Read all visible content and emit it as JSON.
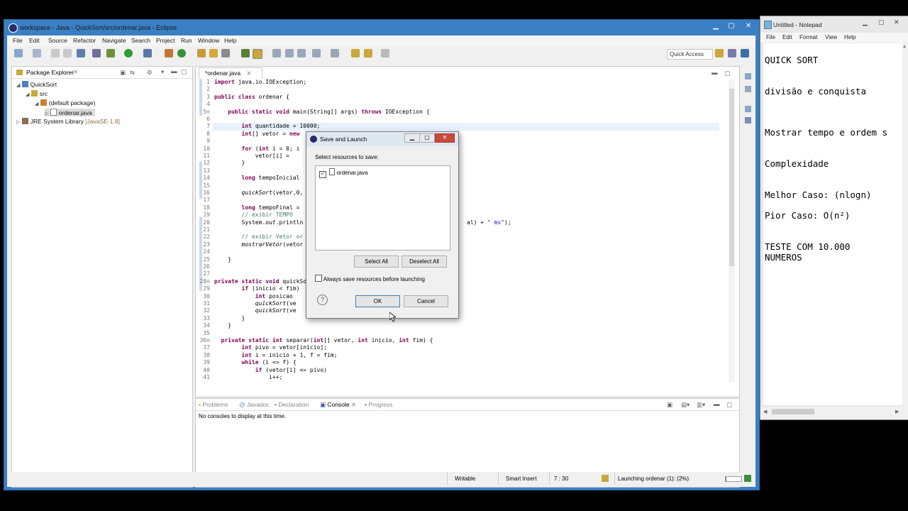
{
  "eclipse": {
    "title": "workspace - Java - QuickSort/src/ordenar.java - Eclipse",
    "menus": [
      "File",
      "Edit",
      "Source",
      "Refactor",
      "Navigate",
      "Search",
      "Project",
      "Run",
      "Window",
      "Help"
    ],
    "quick_access": "Quick Access"
  },
  "package_explorer": {
    "tab_label": "Package Explorer",
    "tree": [
      {
        "label": "QuickSort",
        "level": 0
      },
      {
        "label": "src",
        "level": 1
      },
      {
        "label": "(default package)",
        "level": 2
      },
      {
        "label": "ordenar.java",
        "level": 3
      },
      {
        "label": "JRE System Library",
        "suffix": "[JavaSE-1.8]",
        "level": 0
      }
    ]
  },
  "editor": {
    "tab_label": "*ordenar.java",
    "lines": [
      {
        "n": "1",
        "t": "import java.io.IOException;"
      },
      {
        "n": "2",
        "t": ""
      },
      {
        "n": "3",
        "t": "public class ordenar {"
      },
      {
        "n": "4",
        "t": ""
      },
      {
        "n": "5⊖",
        "t": "    public static void main(String[] args) throws IOException {"
      },
      {
        "n": "6",
        "t": ""
      },
      {
        "n": "7",
        "t": "        int quantidade = 10000;"
      },
      {
        "n": "8",
        "t": "        int[] vetor = new"
      },
      {
        "n": "9",
        "t": ""
      },
      {
        "n": "10",
        "t": "        for (int i = 0; i"
      },
      {
        "n": "11",
        "t": "            vetor[i] ="
      },
      {
        "n": "12",
        "t": "        }"
      },
      {
        "n": "13",
        "t": ""
      },
      {
        "n": "14",
        "t": "        long tempoInicial"
      },
      {
        "n": "15",
        "t": ""
      },
      {
        "n": "16",
        "t": "        quickSort(vetor,0,"
      },
      {
        "n": "17",
        "t": ""
      },
      {
        "n": "18",
        "t": "        long tempoFinal ="
      },
      {
        "n": "19",
        "t": "        // exibir TEMPO"
      },
      {
        "n": "20",
        "t": "        System.out.println"
      },
      {
        "n": "21",
        "t": ""
      },
      {
        "n": "22",
        "t": "        // exibir Vetor or"
      },
      {
        "n": "23",
        "t": "        mostrarVetor(vetor"
      },
      {
        "n": "24",
        "t": ""
      },
      {
        "n": "25",
        "t": "    }"
      },
      {
        "n": "26",
        "t": ""
      },
      {
        "n": "27",
        "t": ""
      },
      {
        "n": "28⊖",
        "t": "private static void quickSo"
      },
      {
        "n": "29",
        "t": "        if (inicio < fim)"
      },
      {
        "n": "30",
        "t": "            int posicao"
      },
      {
        "n": "31",
        "t": "            quickSort(ve"
      },
      {
        "n": "32",
        "t": "            quickSort(ve"
      },
      {
        "n": "33",
        "t": "        }"
      },
      {
        "n": "34",
        "t": "    }"
      },
      {
        "n": "35",
        "t": ""
      },
      {
        "n": "36⊖",
        "t": "  private static int separar(int[] vetor, int inicio, int fim) {"
      },
      {
        "n": "37",
        "t": "        int pivo = vetor[inicio];"
      },
      {
        "n": "38",
        "t": "        int i = inicio + 1, f = fim;"
      },
      {
        "n": "39",
        "t": "        while (i <= f) {"
      },
      {
        "n": "40",
        "t": "            if (vetor[i] <= pivo)"
      },
      {
        "n": "41",
        "t": "                i++;"
      }
    ],
    "line20_tail": "al) + \" ms\");"
  },
  "console": {
    "tabs": [
      "Problems",
      "Javadoc",
      "Declaration",
      "Console",
      "Progress"
    ],
    "message": "No consoles to display at this time."
  },
  "statusbar": {
    "writable": "Writable",
    "insert_mode": "Smart Insert",
    "position": "7 : 30",
    "progress": "Launching ordenar (1): (2%)"
  },
  "dialog": {
    "title": "Save and Launch",
    "prompt": "Select resources to save:",
    "resource": "ordenar.java",
    "select_all": "Select All",
    "deselect_all": "Deselect All",
    "always_save": "Always save resources before launching",
    "ok": "OK",
    "cancel": "Cancel"
  },
  "notepad": {
    "title": "Untitled - Notepad",
    "menus": [
      "File",
      "Edit",
      "Format",
      "View",
      "Help"
    ],
    "lines": [
      {
        "t": "QUICK SORT"
      },
      {
        "t": "divisão e conquista"
      },
      {
        "t": "Mostrar tempo e ordem s"
      },
      {
        "t": "Complexidade"
      },
      {
        "t": "Melhor Caso: (nlogn)"
      },
      {
        "t": "Pior Caso: O(n²)"
      },
      {
        "t": "TESTE COM 10.000"
      },
      {
        "t": "NUMEROS"
      }
    ]
  },
  "colors": {
    "titlebar_active": "#3a7fc4",
    "keyword": "#7f0055",
    "comment": "#3f7f5f",
    "string": "#2a00ff"
  }
}
